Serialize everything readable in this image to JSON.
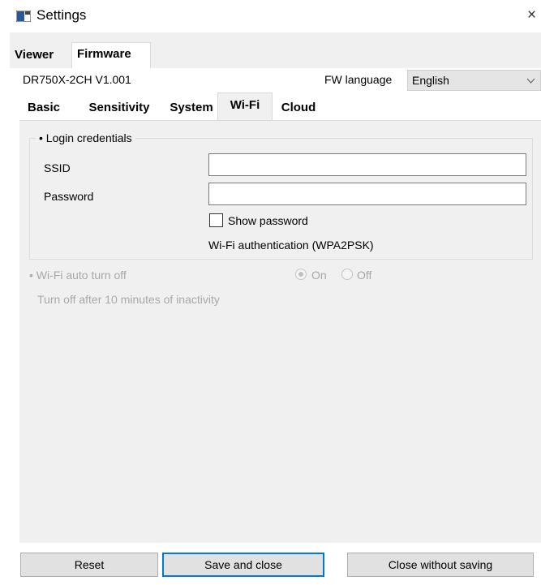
{
  "window": {
    "title": "Settings",
    "app_icon": "settings-window-icon",
    "close_glyph": "×"
  },
  "outer_tabs": [
    {
      "label": "Viewer",
      "selected": false
    },
    {
      "label": "Firmware",
      "selected": true
    }
  ],
  "device": {
    "info": "DR750X-2CH  V1.001",
    "fw_language_label": "FW language",
    "fw_language_value": "English",
    "dropdown_icon": "chevron-down-icon"
  },
  "inner_tabs": [
    {
      "label": "Basic",
      "selected": false
    },
    {
      "label": "Sensitivity",
      "selected": false
    },
    {
      "label": "System",
      "selected": false
    },
    {
      "label": "Wi-Fi",
      "selected": true
    },
    {
      "label": "Cloud",
      "selected": false
    }
  ],
  "login": {
    "group_title": "• Login credentials",
    "ssid_label": "SSID",
    "ssid_value": "",
    "password_label": "Password",
    "password_value": "",
    "show_password_label": "Show password",
    "show_password_checked": false,
    "auth_text": "Wi-Fi authentication (WPA2PSK)"
  },
  "auto_off": {
    "title": "• Wi-Fi auto turn off",
    "description": "Turn off after 10 minutes of inactivity",
    "on_label": "On",
    "off_label": "Off",
    "selected": "On",
    "enabled": false
  },
  "buttons": {
    "reset": "Reset",
    "save_and_close": "Save and close",
    "close_without_saving": "Close without saving"
  },
  "colors": {
    "panel_bg": "#f0f0f0",
    "focus_border": "#0078d7",
    "disabled_text": "#a8a8a8"
  }
}
